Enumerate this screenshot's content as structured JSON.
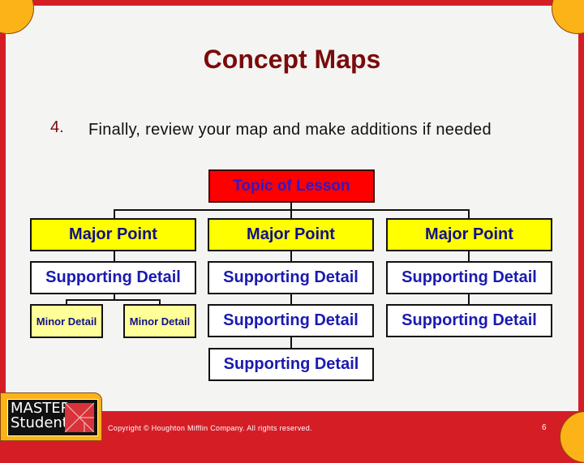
{
  "slide": {
    "title": "Concept Maps",
    "bullet": {
      "number": "4.",
      "text": "Finally, review your map and make additions if needed"
    }
  },
  "concept_map": {
    "topic": "Topic of Lesson",
    "columns": [
      {
        "major": "Major Point",
        "supporting": [
          "Supporting Detail"
        ],
        "minor": [
          "Minor Detail",
          "Minor Detail"
        ]
      },
      {
        "major": "Major Point",
        "supporting": [
          "Supporting Detail",
          "Supporting Detail",
          "Supporting Detail"
        ]
      },
      {
        "major": "Major Point",
        "supporting": [
          "Supporting Detail",
          "Supporting Detail"
        ]
      }
    ]
  },
  "footer": {
    "logo_line1": "MASTER",
    "logo_line2": "Student",
    "copyright": "Copyright © Houghton Mifflin Company. All rights reserved.",
    "page_number": "6"
  },
  "colors": {
    "frame": "#d51d26",
    "corner": "#fbb317",
    "topic_fill": "#ff0000",
    "major_fill": "#ffff00",
    "minor_fill": "#ffff99",
    "text_blue": "#1a1ab0",
    "title": "#7a0b0b"
  }
}
